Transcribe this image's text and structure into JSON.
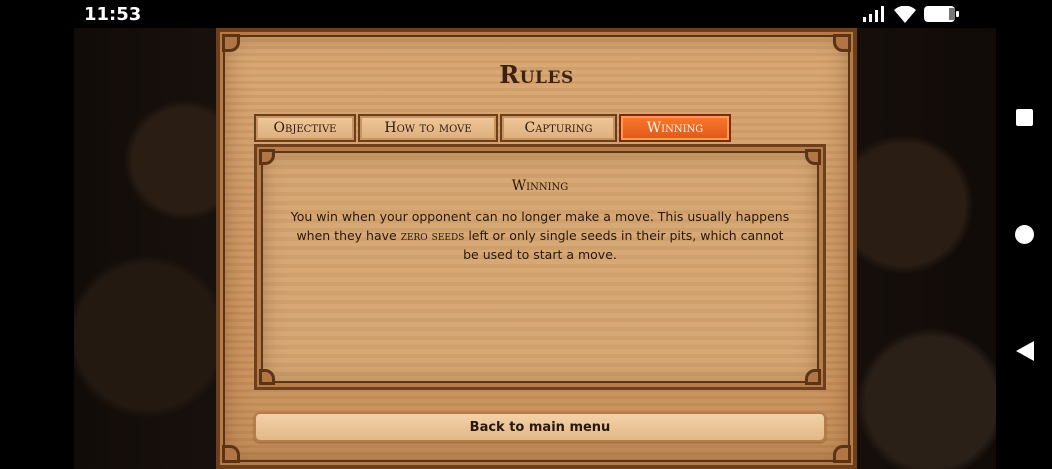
{
  "status_bar": {
    "time": "11:53",
    "icons": [
      "signal-icon",
      "wifi-icon",
      "battery-icon"
    ]
  },
  "navigation": {
    "buttons": [
      "recent-apps-button",
      "home-button",
      "back-button"
    ]
  },
  "rules": {
    "title": "Rules",
    "tabs": [
      {
        "label": "Objective",
        "active": false
      },
      {
        "label": "How to move",
        "active": false
      },
      {
        "label": "Capturing",
        "active": false
      },
      {
        "label": "Winning",
        "active": true
      }
    ],
    "content": {
      "heading": "Winning",
      "body_part1": "You win when your opponent can no longer make a move. This usually happens when they have ",
      "body_highlight": "zero seeds",
      "body_part2": " left or only single seeds in their pits, which cannot be used to start a move."
    },
    "back_button_label": "Back to main menu"
  },
  "colors": {
    "active_tab": "#e0561a",
    "wood": "#cf9a66",
    "dark_wood": "#6e3f1d"
  }
}
